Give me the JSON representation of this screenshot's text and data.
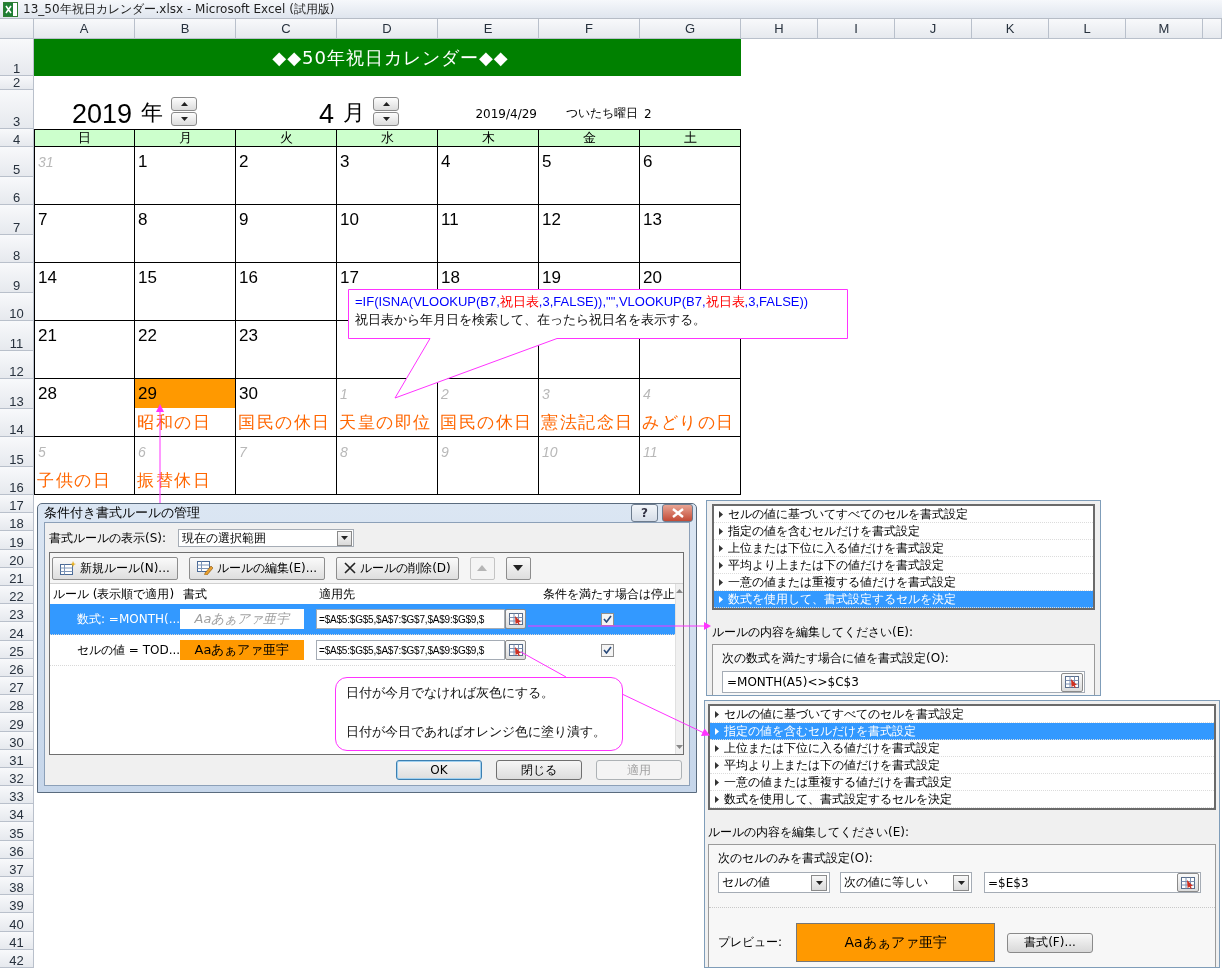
{
  "window": {
    "title": "13_50年祝日カレンダー.xlsx - Microsoft Excel (試用版)"
  },
  "sheet": {
    "columns": [
      "A",
      "B",
      "C",
      "D",
      "E",
      "F",
      "G",
      "H",
      "I",
      "J",
      "K",
      "L",
      "M"
    ],
    "rows": [
      "1",
      "2",
      "3",
      "4",
      "5",
      "6",
      "7",
      "8",
      "9",
      "10",
      "11",
      "12",
      "13",
      "14",
      "15",
      "16",
      "17",
      "18",
      "19",
      "20",
      "21",
      "22",
      "23",
      "24",
      "25",
      "26",
      "27",
      "28",
      "29",
      "30",
      "31",
      "32",
      "33",
      "34",
      "35",
      "36",
      "37",
      "38",
      "39",
      "40",
      "41",
      "42"
    ],
    "title": "◆◆50年祝日カレンダー◆◆",
    "year": {
      "value": "2019",
      "unit": "年"
    },
    "month": {
      "value": "4",
      "unit": "月"
    },
    "today": "2019/4/29",
    "first_weekday_label": "ついたち曜日",
    "first_weekday": "2",
    "weekdays": [
      "日",
      "月",
      "火",
      "水",
      "木",
      "金",
      "土"
    ],
    "weeks": [
      [
        {
          "day": "31",
          "in_month": false,
          "today": false
        },
        {
          "day": "1",
          "in_month": true,
          "today": false
        },
        {
          "day": "2",
          "in_month": true,
          "today": false
        },
        {
          "day": "3",
          "in_month": true,
          "today": false
        },
        {
          "day": "4",
          "in_month": true,
          "today": false
        },
        {
          "day": "5",
          "in_month": true,
          "today": false
        },
        {
          "day": "6",
          "in_month": true,
          "today": false
        }
      ],
      [
        {
          "day": "7",
          "in_month": true,
          "today": false
        },
        {
          "day": "8",
          "in_month": true,
          "today": false
        },
        {
          "day": "9",
          "in_month": true,
          "today": false
        },
        {
          "day": "10",
          "in_month": true,
          "today": false
        },
        {
          "day": "11",
          "in_month": true,
          "today": false
        },
        {
          "day": "12",
          "in_month": true,
          "today": false
        },
        {
          "day": "13",
          "in_month": true,
          "today": false
        }
      ],
      [
        {
          "day": "14",
          "in_month": true,
          "today": false
        },
        {
          "day": "15",
          "in_month": true,
          "today": false
        },
        {
          "day": "16",
          "in_month": true,
          "today": false
        },
        {
          "day": "17",
          "in_month": true,
          "today": false
        },
        {
          "day": "18",
          "in_month": true,
          "today": false
        },
        {
          "day": "19",
          "in_month": true,
          "today": false
        },
        {
          "day": "20",
          "in_month": true,
          "today": false
        }
      ],
      [
        {
          "day": "21",
          "in_month": true,
          "today": false
        },
        {
          "day": "22",
          "in_month": true,
          "today": false
        },
        {
          "day": "23",
          "in_month": true,
          "today": false
        }
      ],
      [
        {
          "day": "28",
          "in_month": true,
          "today": false
        },
        {
          "day": "29",
          "in_month": true,
          "today": true,
          "holiday": "昭和の日"
        },
        {
          "day": "30",
          "in_month": true,
          "today": false,
          "holiday": "国民の休日"
        },
        {
          "day": "1",
          "in_month": false,
          "today": false,
          "holiday": "天皇の即位"
        },
        {
          "day": "2",
          "in_month": false,
          "today": false,
          "holiday": "国民の休日"
        },
        {
          "day": "3",
          "in_month": false,
          "today": false,
          "holiday": "憲法記念日"
        },
        {
          "day": "4",
          "in_month": false,
          "today": false,
          "holiday": "みどりの日"
        }
      ],
      [
        {
          "day": "5",
          "in_month": false,
          "today": false,
          "holiday": "子供の日"
        },
        {
          "day": "6",
          "in_month": false,
          "today": false,
          "holiday": "振替休日"
        },
        {
          "day": "7",
          "in_month": false,
          "today": false
        },
        {
          "day": "8",
          "in_month": false,
          "today": false
        },
        {
          "day": "9",
          "in_month": false,
          "today": false
        },
        {
          "day": "10",
          "in_month": false,
          "today": false
        },
        {
          "day": "11",
          "in_month": false,
          "today": false
        }
      ]
    ]
  },
  "formula_callout": {
    "segments": [
      {
        "text": "=IF(ISNA(VLOOKUP(B7,",
        "color": "#0000ff"
      },
      {
        "text": "祝日表",
        "color": "#ff0000"
      },
      {
        "text": ",3,FALSE)),\"\",VLOOKUP(B7,",
        "color": "#0000ff"
      },
      {
        "text": "祝日表",
        "color": "#ff0000"
      },
      {
        "text": ",3,FALSE))",
        "color": "#0000ff"
      }
    ],
    "note": "祝日表から年月日を検索して、在ったら祝日名を表示する。"
  },
  "dialog": {
    "title": "条件付き書式ルールの管理",
    "help": "?",
    "show_label": "書式ルールの表示(S):",
    "show_value": "現在の選択範囲",
    "toolbar": [
      {
        "kind": "new",
        "label": "新規ルール(N)...",
        "disabled": false
      },
      {
        "kind": "edit",
        "label": "ルールの編集(E)...",
        "disabled": false
      },
      {
        "kind": "delete",
        "label": "ルールの削除(D)",
        "disabled": false
      },
      {
        "kind": "up",
        "disabled": true
      },
      {
        "kind": "down",
        "disabled": false
      }
    ],
    "columns": [
      "ルール (表示順で適用)",
      "書式",
      "適用先",
      "条件を満たす場合は停止"
    ],
    "rules": [
      {
        "rule": "数式: =MONTH(...",
        "preview": "Aaあぁアァ亜宇",
        "kind": "gray-italic",
        "applies_to": "=$A$5:$G$5,$A$7:$G$7,$A$9:$G$9,$",
        "stop_if_true": true,
        "selected": true
      },
      {
        "rule": "セルの値 = TOD...",
        "preview": "Aaあぁアァ亜宇",
        "kind": "orange-fill",
        "applies_to": "=$A$5:$G$5,$A$7:$G$7,$A$9:$G$9,$",
        "stop_if_true": true,
        "selected": false
      }
    ],
    "buttons": [
      {
        "label": "OK",
        "disabled": false
      },
      {
        "label": "閉じる",
        "disabled": false
      },
      {
        "label": "適用",
        "disabled": true
      }
    ]
  },
  "rule_note": {
    "lines": [
      "日付が今月でなければ灰色にする。",
      "日付が今日であればオレンジ色に塗り潰す。"
    ]
  },
  "edit_panels": [
    {
      "kind": "formula",
      "rule_types": [
        {
          "label": "セルの値に基づいてすべてのセルを書式設定",
          "selected": false
        },
        {
          "label": "指定の値を含むセルだけを書式設定",
          "selected": false
        },
        {
          "label": "上位または下位に入る値だけを書式設定",
          "selected": false
        },
        {
          "label": "平均より上または下の値だけを書式設定",
          "selected": false
        },
        {
          "label": "一意の値または重複する値だけを書式設定",
          "selected": false
        },
        {
          "label": "数式を使用して、書式設定するセルを決定",
          "selected": true
        }
      ],
      "edit_label": "ルールの内容を編集してください(E):",
      "condition_label": "次の数式を満たす場合に値を書式設定(O):",
      "formula": "=MONTH(A5)<>$C$3"
    },
    {
      "kind": "cell_value",
      "rule_types": [
        {
          "label": "セルの値に基づいてすべてのセルを書式設定",
          "selected": false
        },
        {
          "label": "指定の値を含むセルだけを書式設定",
          "selected": true
        },
        {
          "label": "上位または下位に入る値だけを書式設定",
          "selected": false
        },
        {
          "label": "平均より上または下の値だけを書式設定",
          "selected": false
        },
        {
          "label": "一意の値または重複する値だけを書式設定",
          "selected": false
        },
        {
          "label": "数式を使用して、書式設定するセルを決定",
          "selected": false
        }
      ],
      "edit_label": "ルールの内容を編集してください(E):",
      "condition_label": "次のセルのみを書式設定(O):",
      "operand": "セルの値",
      "operator": "次の値に等しい",
      "value": "=$E$3",
      "preview_label": "プレビュー:",
      "preview": "Aaあぁアァ亜宇",
      "format_button": "書式(F)..."
    }
  ]
}
